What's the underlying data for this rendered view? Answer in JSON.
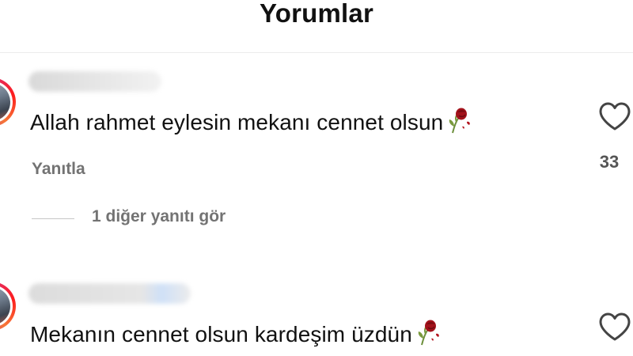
{
  "header": {
    "title": "Yorumlar"
  },
  "comments": [
    {
      "text": "Allah rahmet eylesin mekanı cennet olsun",
      "emoji_icon": "wilted-rose-icon",
      "like_count": "33",
      "reply_label": "Yanıtla",
      "view_replies_label": "1 diğer yanıtı gör"
    },
    {
      "text": "Mekanın cennet olsun kardeşim üzdün",
      "emoji_icon": "wilted-rose-icon"
    }
  ],
  "colors": {
    "text_primary": "#111111",
    "text_secondary": "#737373",
    "divider": "#ececec",
    "story_ring": "#e1306c"
  }
}
